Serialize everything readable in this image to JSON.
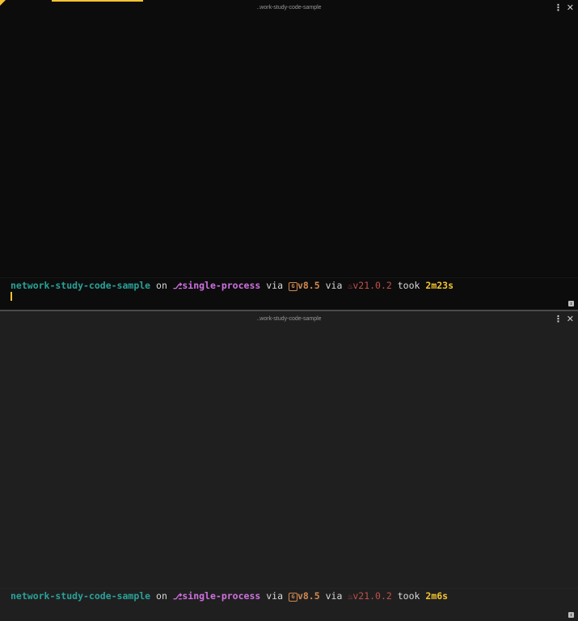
{
  "panes": [
    {
      "title": "..work-study-code-sample",
      "prompt": {
        "directory": "network-study-code-sample",
        "on": "on",
        "branch": "single-process",
        "via1": "via",
        "gradle_version": "v8.5",
        "via2": "via",
        "java_version": "v21.0.2",
        "took": "took",
        "duration": "2m23s"
      }
    },
    {
      "title": "..work-study-code-sample",
      "prompt": {
        "directory": "network-study-code-sample",
        "on": "on",
        "branch": "single-process",
        "via1": "via",
        "gradle_version": "v8.5",
        "via2": "via",
        "java_version": "v21.0.2",
        "took": "took",
        "duration": "2m6s"
      }
    }
  ],
  "icons": {
    "more": "⋮",
    "close": "✕",
    "branch": "git-branch-icon",
    "gradle": "gradle-icon",
    "java": "java-icon",
    "scroll": "scroll-indicator-icon"
  },
  "colors": {
    "directory": "#2aa198",
    "branch": "#d070e0",
    "gradle": "#d08a50",
    "java": "#c0504d",
    "duration": "#f4c430",
    "accent": "#f4c430"
  }
}
